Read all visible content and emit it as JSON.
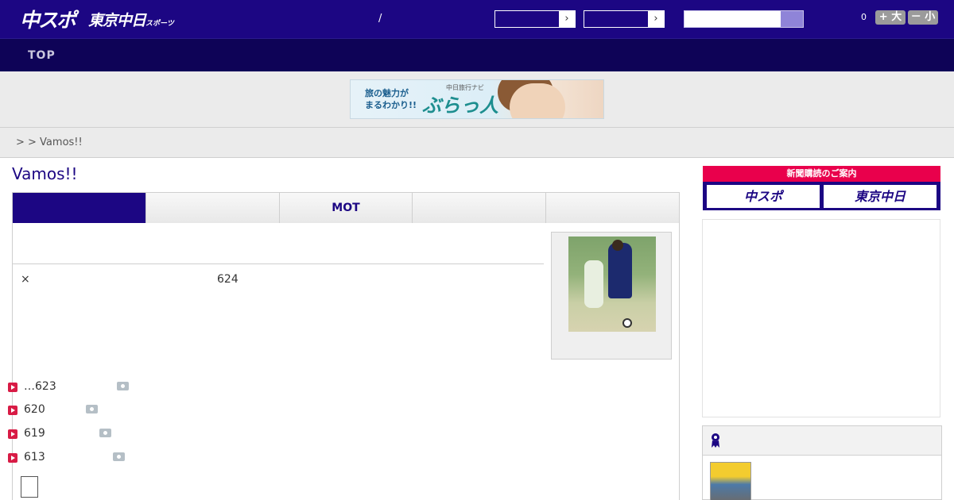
{
  "header": {
    "logo_main": "中スポ",
    "logo_sub": "東京中日",
    "logo_sub_small": "スポーツ",
    "separator": "/",
    "select1_arrow": "›",
    "select2_arrow": "›",
    "font_size_label": "0",
    "font_larger": "+ 大",
    "font_smaller": "－ 小",
    "bg_color": "#1c0683"
  },
  "nav": {
    "top_label": "TOP"
  },
  "banner": {
    "left_text_line1": "旅の魅力が",
    "left_text_line2": "まるわかり!!",
    "sub_text": "中日旅行ナビ",
    "main_text": "ぶらっ人"
  },
  "breadcrumb": {
    "text": ">  > Vamos!!"
  },
  "page": {
    "title": "Vamos!!",
    "tabs": [
      {
        "label": "",
        "active": true
      },
      {
        "label": "",
        "active": false
      },
      {
        "label": "MOT",
        "active": false
      },
      {
        "label": "",
        "active": false
      },
      {
        "label": "",
        "active": false
      }
    ],
    "article": {
      "times_sign": "×",
      "count": "624"
    },
    "list": [
      {
        "text": "…623"
      },
      {
        "text": "620"
      },
      {
        "text": "619"
      },
      {
        "text": "613"
      }
    ]
  },
  "sidebar": {
    "subscribe_header": "新聞購読のご案内",
    "subscribe_btn1": "中スポ",
    "subscribe_btn2": "東京中日",
    "accent_color": "#e9004c"
  }
}
